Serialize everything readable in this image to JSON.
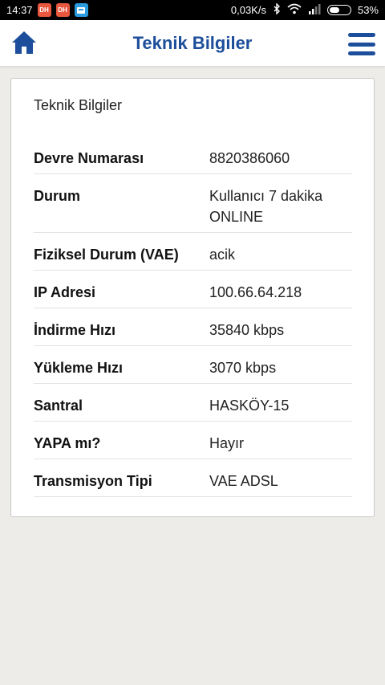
{
  "status_bar": {
    "time": "14:37",
    "notif1": "DH",
    "notif2": "DH",
    "net_speed": "0,03K/s",
    "battery": "53%",
    "battery_level": 0.53
  },
  "app_bar": {
    "title": "Teknik Bilgiler",
    "home_icon": "home-icon",
    "menu_icon": "hamburger-menu-icon",
    "accent_color": "#1d4e9b"
  },
  "card": {
    "title": "Teknik Bilgiler",
    "rows": [
      {
        "label": "Devre Numarası",
        "value": "8820386060"
      },
      {
        "label": "Durum",
        "value": "Kullanıcı 7 dakika ONLINE"
      },
      {
        "label": "Fiziksel Durum (VAE)",
        "value": "acik"
      },
      {
        "label": "IP Adresi",
        "value": "100.66.64.218"
      },
      {
        "label": "İndirme Hızı",
        "value": "35840 kbps"
      },
      {
        "label": "Yükleme Hızı",
        "value": "3070 kbps"
      },
      {
        "label": "Santral",
        "value": "HASKÖY-15"
      },
      {
        "label": "YAPA mı?",
        "value": "Hayır"
      },
      {
        "label": "Transmisyon Tipi",
        "value": "VAE ADSL"
      }
    ]
  }
}
